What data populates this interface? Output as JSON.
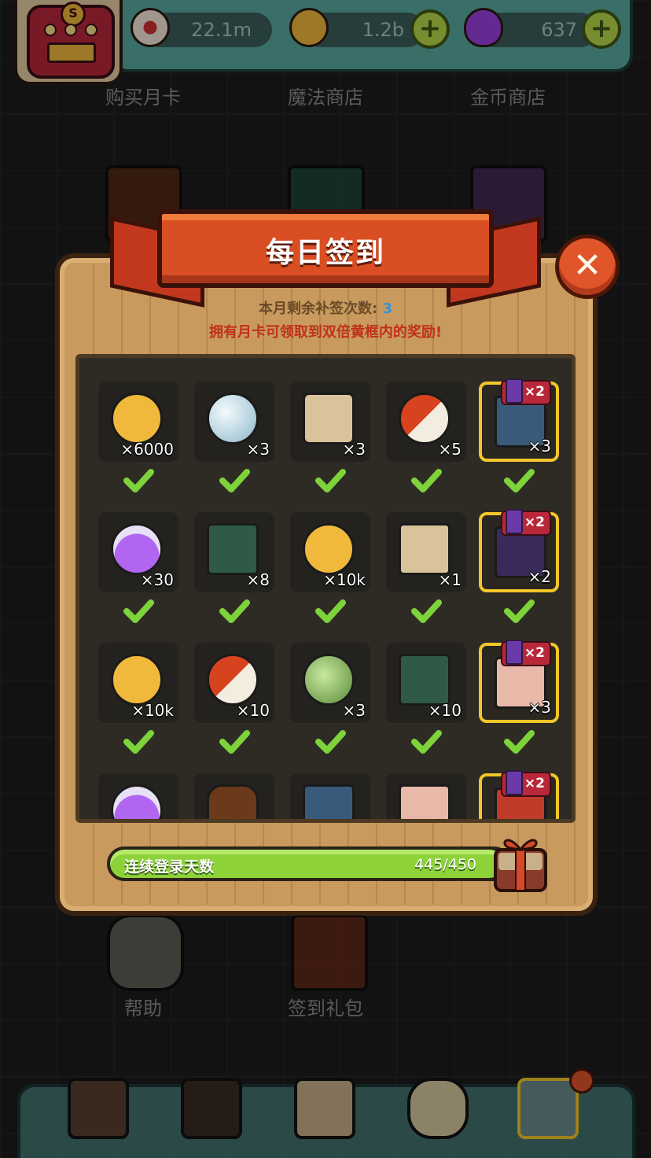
{
  "top_bar": {
    "eyes": "22.1m",
    "gold": "1.2b",
    "potion": "637"
  },
  "shops": [
    "购买月卡",
    "魔法商店",
    "金币商店"
  ],
  "dialog": {
    "title": "每日签到",
    "remaining_label": "本月剩余补签次数:",
    "remaining_value": "3",
    "month_card_note": "拥有月卡可领取到双倍黄框内的奖励!",
    "x2_label": "×2",
    "rows": [
      [
        {
          "icon": "gold-coin",
          "qty": "×6000",
          "claimed": true,
          "bonus": false
        },
        {
          "icon": "pearl-orb",
          "qty": "×3",
          "claimed": true,
          "bonus": false
        },
        {
          "icon": "treasure-map",
          "qty": "×3",
          "claimed": true,
          "bonus": false
        },
        {
          "icon": "pill-capsule",
          "qty": "×5",
          "claimed": true,
          "bonus": false
        },
        {
          "icon": "monster-card",
          "qty": "×3",
          "claimed": true,
          "bonus": true
        }
      ],
      [
        {
          "icon": "purple-potion",
          "qty": "×30",
          "claimed": true,
          "bonus": false
        },
        {
          "icon": "video-card",
          "qty": "×8",
          "claimed": true,
          "bonus": false
        },
        {
          "icon": "gold-coin",
          "qty": "×10k",
          "claimed": true,
          "bonus": false
        },
        {
          "icon": "deer-ticket",
          "qty": "×1",
          "claimed": true,
          "bonus": false
        },
        {
          "icon": "cauldron-card",
          "qty": "×2",
          "claimed": true,
          "bonus": true
        }
      ],
      [
        {
          "icon": "gold-coin",
          "qty": "×10k",
          "claimed": true,
          "bonus": false
        },
        {
          "icon": "pill-capsule",
          "qty": "×10",
          "claimed": true,
          "bonus": false
        },
        {
          "icon": "green-egg",
          "qty": "×3",
          "claimed": true,
          "bonus": false
        },
        {
          "icon": "video-card",
          "qty": "×10",
          "claimed": true,
          "bonus": false
        },
        {
          "icon": "red-scroll",
          "qty": "×3",
          "claimed": true,
          "bonus": true
        }
      ],
      [
        {
          "icon": "purple-potion",
          "qty": "",
          "claimed": false,
          "bonus": false
        },
        {
          "icon": "herb-bundle",
          "qty": "",
          "claimed": false,
          "bonus": false
        },
        {
          "icon": "monster-card",
          "qty": "",
          "claimed": false,
          "bonus": false
        },
        {
          "icon": "red-scroll",
          "qty": "",
          "claimed": false,
          "bonus": false
        },
        {
          "icon": "red-chest",
          "qty": "",
          "claimed": false,
          "bonus": true
        }
      ]
    ],
    "streak": {
      "label": "连续登录天数",
      "current": 445,
      "total": 450,
      "text": "445/450"
    }
  },
  "bottom_labels": [
    "帮助",
    "签到礼包"
  ],
  "colors": {
    "gold": "#f1b93b",
    "check_green": "#7ed23a",
    "bonus_border": "#f3c62a",
    "ribbon": "#d94e22"
  }
}
